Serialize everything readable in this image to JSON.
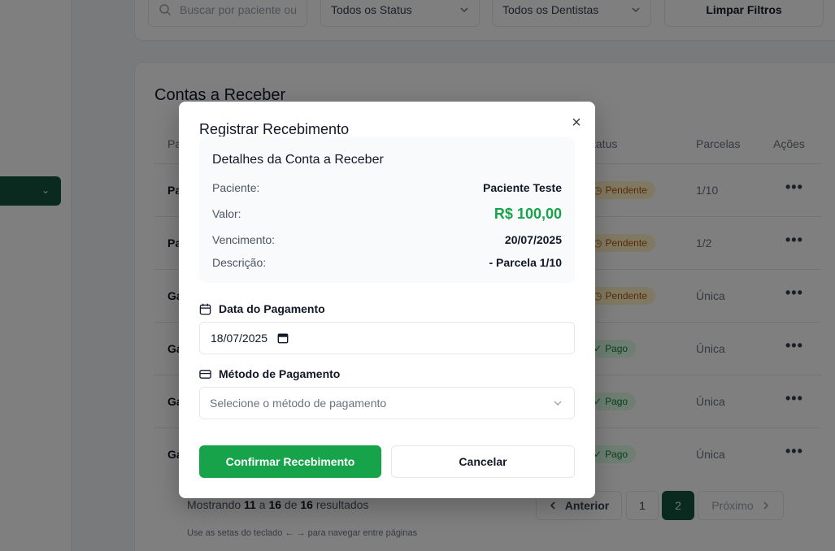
{
  "filters": {
    "search_placeholder": "Buscar por paciente ou",
    "status_value": "Todos os Status",
    "dentist_value": "Todos os Dentistas",
    "clear_label": "Limpar Filtros"
  },
  "table": {
    "title": "Contas a Receber",
    "headers": {
      "patient_partial": "Pa",
      "status_partial": "tatus",
      "installments": "Parcelas",
      "actions": "Ações"
    },
    "rows": [
      {
        "name_partial": "Pa",
        "status": "Pendente",
        "installments": "1/10"
      },
      {
        "name_partial": "Pa",
        "status": "Pendente",
        "installments": "1/2"
      },
      {
        "name_partial": "Ga",
        "status": "Pendente",
        "installments": "Única"
      },
      {
        "name_partial": "Ga",
        "status": "Pago",
        "installments": "Única"
      },
      {
        "name_partial": "Ga",
        "status": "Pago",
        "installments": "Única"
      },
      {
        "name_partial": "Ga",
        "status": "Pago",
        "installments": "Única"
      }
    ],
    "actions_glyph": "•••"
  },
  "pagination": {
    "showing_prefix": "Mostrando",
    "from": "11",
    "to_word": "a",
    "to": "16",
    "of_word": "de",
    "total": "16",
    "suffix": "resultados",
    "hint": "Use as setas do teclado ← → para navegar entre páginas",
    "prev_label": "Anterior",
    "page_1": "1",
    "page_2": "2",
    "next_label": "Próximo"
  },
  "modal": {
    "title": "Registrar Recebimento",
    "close_glyph": "×",
    "details": {
      "title": "Detalhes da Conta a Receber",
      "patient_label": "Paciente:",
      "patient_value": "Paciente Teste",
      "amount_label": "Valor:",
      "amount_value": "R$ 100,00",
      "due_label": "Vencimento:",
      "due_value": "20/07/2025",
      "description_label": "Descrição:",
      "description_value": "- Parcela 1/10"
    },
    "payment_date_label": "Data do Pagamento",
    "payment_date_value": "18/07/2025",
    "payment_method_label": "Método de Pagamento",
    "payment_method_placeholder": "Selecione o método de pagamento",
    "confirm_label": "Confirmar Recebimento",
    "cancel_label": "Cancelar"
  },
  "colors": {
    "accent_green": "#16a34a",
    "dark_teal": "#14533f",
    "pending_bg": "#fef3c7",
    "paid_bg": "#dcfce7"
  }
}
